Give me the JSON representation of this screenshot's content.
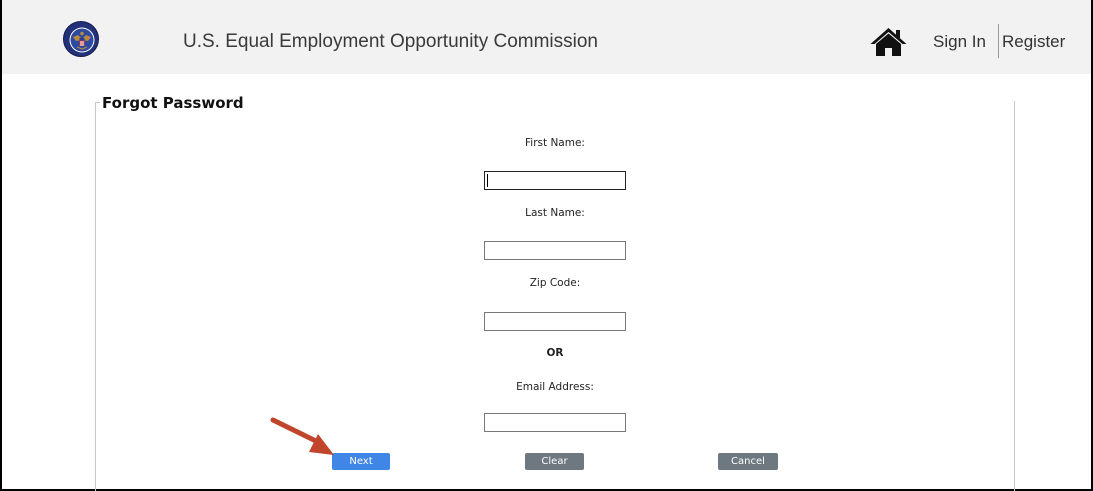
{
  "header": {
    "site_title": "U.S. Equal Employment Opportunity Commission",
    "seal_icon": "eeoc-seal-icon",
    "home_icon": "home-icon",
    "sign_in_label": "Sign In",
    "register_label": "Register"
  },
  "form": {
    "legend": "Forgot Password",
    "first_name": {
      "label": "First Name:",
      "value": "",
      "focused": true
    },
    "last_name": {
      "label": "Last Name:",
      "value": ""
    },
    "zip_code": {
      "label": "Zip Code:",
      "value": ""
    },
    "separator": "OR",
    "email": {
      "label": "Email Address:",
      "value": ""
    }
  },
  "buttons": {
    "next": "Next",
    "clear": "Clear",
    "cancel": "Cancel"
  },
  "annotation": {
    "arrow_icon": "arrow-pointer-icon",
    "arrow_color": "#c0452a"
  },
  "colors": {
    "header_background": "#f2f2f2",
    "primary_button": "#3f86e6",
    "secondary_button": "#6d7880",
    "title_text": "#3a3a3a"
  }
}
